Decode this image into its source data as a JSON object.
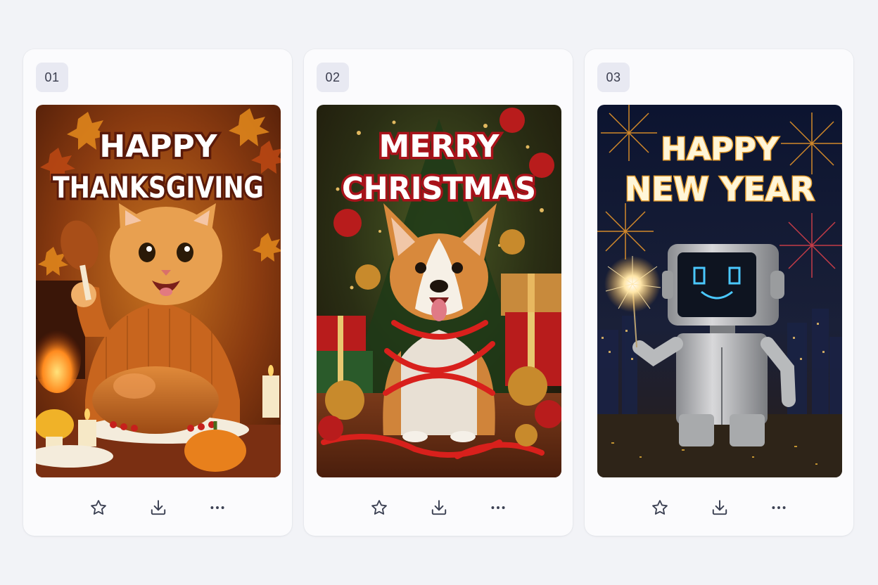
{
  "cards": [
    {
      "number": "01",
      "greeting_line1": "HAPPY",
      "greeting_line2": "THANKSGIVING",
      "subject": "orange cat in sweater holding turkey leg at thanksgiving table",
      "actions": {
        "favorite": "star-icon",
        "download": "download-icon",
        "more": "more-icon"
      }
    },
    {
      "number": "02",
      "greeting_line1": "MERRY",
      "greeting_line2": "CHRISTMAS",
      "subject": "corgi wrapped in red ribbon in front of christmas tree",
      "actions": {
        "favorite": "star-icon",
        "download": "download-icon",
        "more": "more-icon"
      }
    },
    {
      "number": "03",
      "greeting_line1": "HAPPY",
      "greeting_line2": "NEW YEAR",
      "subject": "silver robot with smiley screen face holding sparkler, fireworks",
      "actions": {
        "favorite": "star-icon",
        "download": "download-icon",
        "more": "more-icon"
      }
    }
  ],
  "colors": {
    "page_bg": "#f2f3f7",
    "card_bg": "#fbfbfd",
    "badge_bg": "#e8e9f2",
    "icon": "#3c4153"
  }
}
